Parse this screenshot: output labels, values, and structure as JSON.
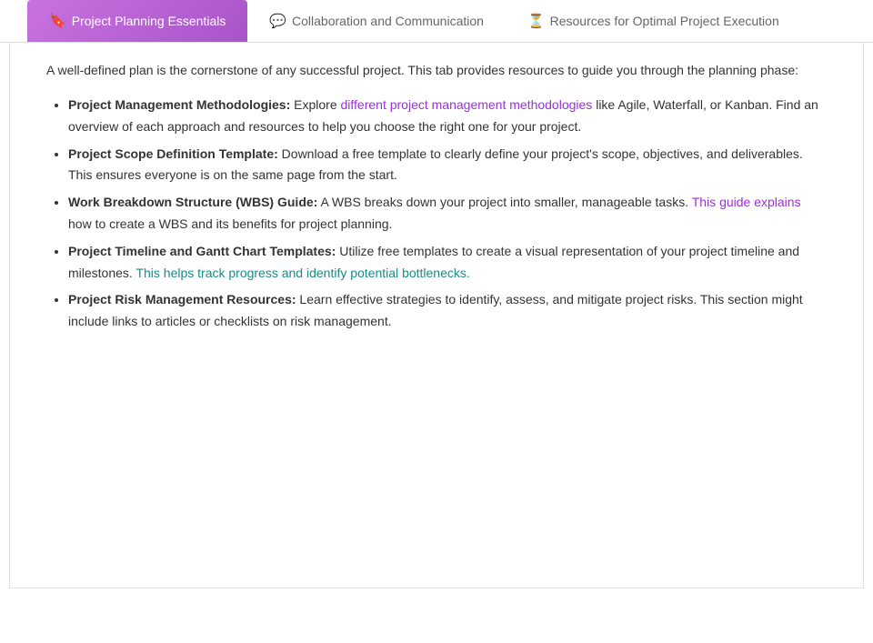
{
  "tabs": [
    {
      "id": "tab-planning",
      "label": "Project Planning Essentials",
      "icon": "🔖",
      "active": true
    },
    {
      "id": "tab-collaboration",
      "label": "Collaboration and Communication",
      "icon": "💬",
      "active": false
    },
    {
      "id": "tab-resources",
      "label": "Resources for Optimal Project Execution",
      "icon": "⏳",
      "active": false
    }
  ],
  "content": {
    "intro": "A well-defined plan is the cornerstone of any successful project. This tab provides resources to guide you through the planning phase:",
    "items": [
      {
        "id": "item-methodologies",
        "bold": "Project Management Methodologies:",
        "before_link": "Explore ",
        "link_text": "different project management methodologies",
        "link_class": "link-purple",
        "after_link": " like Agile, Waterfall, or Kanban. Find an overview of each approach and resources to help you choose the right one for your project."
      },
      {
        "id": "item-scope",
        "bold": "Project Scope Definition Template:",
        "text": " Download a free template to clearly define your project's scope, objectives, and deliverables. This ensures everyone is on the same page from the start."
      },
      {
        "id": "item-wbs",
        "bold": "Work Breakdown Structure (WBS) Guide:",
        "before_link": " A WBS breaks down your project into smaller, manageable tasks. ",
        "link_text": "This guide explains",
        "link_class": "link-purple",
        "after_link": " how to create a WBS and its benefits for project planning."
      },
      {
        "id": "item-gantt",
        "bold": "Project Timeline and Gantt Chart Templates:",
        "before_link": " Utilize free templates to create a visual representation of your project timeline and milestones. ",
        "link_text": "This helps track progress and identify potential bottlenecks.",
        "link_class": "link-teal",
        "after_link": ""
      },
      {
        "id": "item-risk",
        "bold": "Project Risk Management Resources:",
        "text": " Learn effective strategies to identify, assess, and mitigate project risks. This section might include links to articles or checklists on risk management."
      }
    ]
  }
}
